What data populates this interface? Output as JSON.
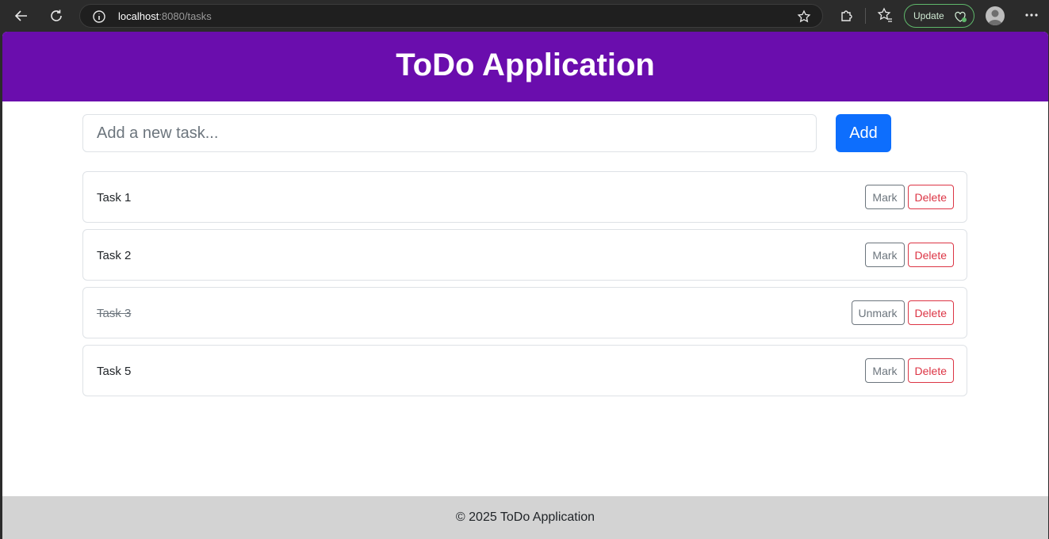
{
  "browser": {
    "url_host": "localhost",
    "url_path": ":8080/tasks",
    "update_label": "Update"
  },
  "header": {
    "title": "ToDo Application"
  },
  "form": {
    "placeholder": "Add a new task...",
    "add_label": "Add"
  },
  "tasks": [
    {
      "text": "Task 1",
      "completed": false,
      "toggle_label": "Mark",
      "delete_label": "Delete"
    },
    {
      "text": "Task 2",
      "completed": false,
      "toggle_label": "Mark",
      "delete_label": "Delete"
    },
    {
      "text": "Task 3",
      "completed": true,
      "toggle_label": "Unmark",
      "delete_label": "Delete"
    },
    {
      "text": "Task 5",
      "completed": false,
      "toggle_label": "Mark",
      "delete_label": "Delete"
    }
  ],
  "footer": {
    "text": "© 2025 ToDo Application"
  },
  "colors": {
    "header_bg": "#6a0dad",
    "primary": "#0d6efd",
    "danger": "#dc3545",
    "secondary": "#6c757d",
    "footer_bg": "#d3d3d3"
  }
}
